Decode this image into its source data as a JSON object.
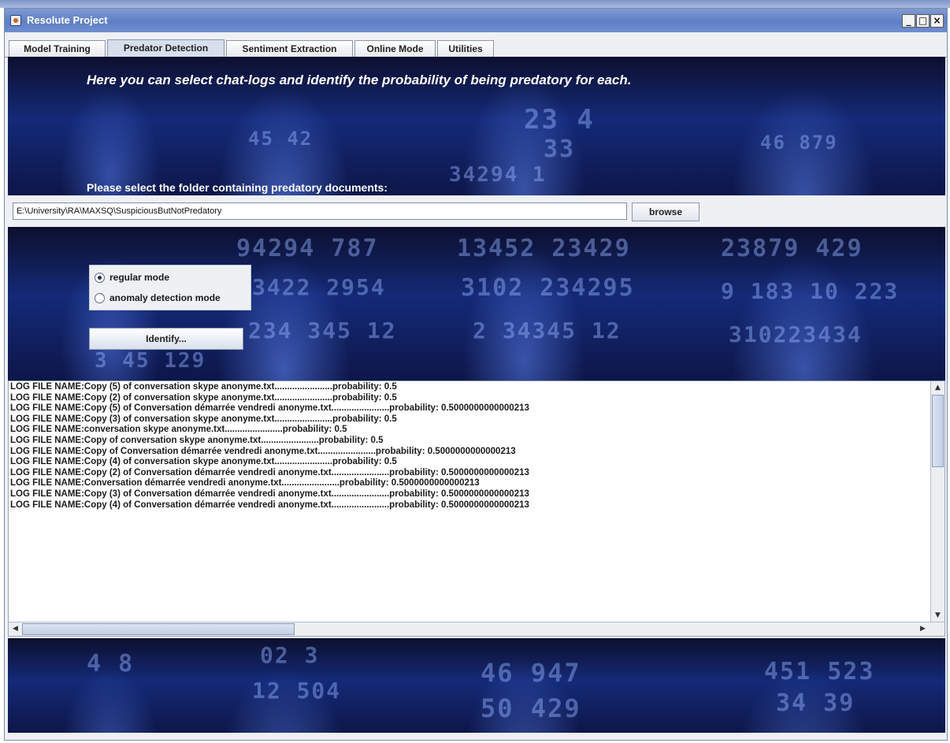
{
  "window": {
    "title": "Resolute Project",
    "controls": {
      "minimize": "_",
      "maximize": "□",
      "close": "×"
    }
  },
  "tabs": [
    {
      "label": "Model Training",
      "active": false
    },
    {
      "label": "Predator Detection",
      "active": true
    },
    {
      "label": "Sentiment Extraction",
      "active": false
    },
    {
      "label": "Online Mode",
      "active": false
    },
    {
      "label": "Utilities",
      "active": false
    }
  ],
  "detection": {
    "instruction": "Here you can select chat-logs and identify the probability of being predatory for each.",
    "select_label": "Please select the folder containing predatory documents:",
    "folder_path": "E:\\University\\RA\\MAXSQ\\SuspiciousButNotPredatory",
    "browse_label": "browse",
    "modes": [
      {
        "label": "regular mode",
        "selected": true
      },
      {
        "label": "anomaly detection mode",
        "selected": false
      }
    ],
    "identify_label": "Identify..."
  },
  "results": [
    "LOG FILE NAME:Copy (5) of conversation  skype anonyme.txt.......................probability: 0.5",
    "LOG FILE NAME:Copy (2) of conversation  skype anonyme.txt.......................probability: 0.5",
    "LOG FILE NAME:Copy (5) of Conversation démarrée vendredi anonyme.txt.......................probability: 0.5000000000000213",
    "LOG FILE NAME:Copy (3) of conversation  skype anonyme.txt.......................probability: 0.5",
    "LOG FILE NAME:conversation  skype anonyme.txt.......................probability: 0.5",
    "LOG FILE NAME:Copy of conversation  skype anonyme.txt.......................probability: 0.5",
    "LOG FILE NAME:Copy of Conversation démarrée vendredi anonyme.txt.......................probability: 0.5000000000000213",
    "LOG FILE NAME:Copy (4) of conversation  skype anonyme.txt.......................probability: 0.5",
    "LOG FILE NAME:Copy (2) of Conversation démarrée vendredi anonyme.txt.......................probability: 0.5000000000000213",
    "LOG FILE NAME:Conversation démarrée vendredi anonyme.txt.......................probability: 0.5000000000000213",
    "LOG FILE NAME:Copy (3) of Conversation démarrée vendredi anonyme.txt.......................probability: 0.5000000000000213",
    "LOG FILE NAME:Copy (4) of Conversation démarrée vendredi anonyme.txt.......................probability: 0.5000000000000213"
  ],
  "colors": {
    "title_bar": "#6a89cb",
    "background_art": "#142a78",
    "panel": "#eef0f4"
  }
}
